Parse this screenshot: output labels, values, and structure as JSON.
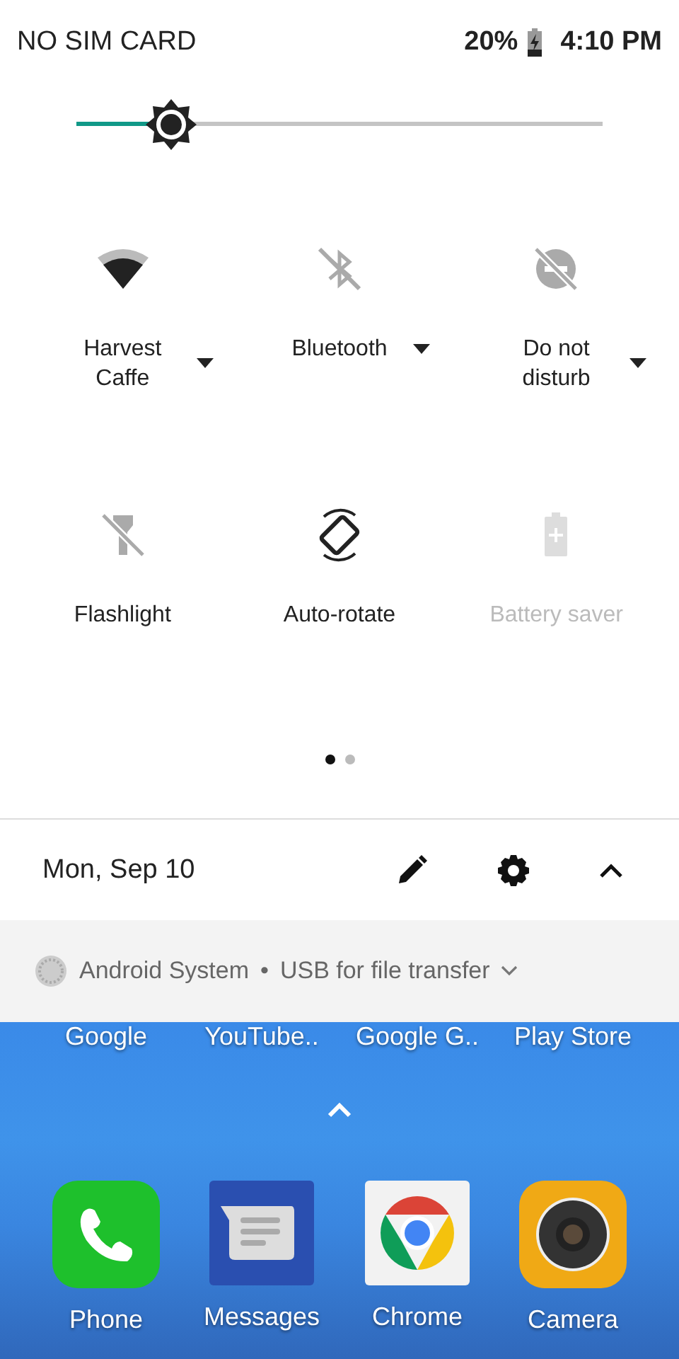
{
  "status_bar": {
    "carrier": "NO SIM CARD",
    "battery": "20%",
    "time": "4:10 PM"
  },
  "brightness": {
    "level": 0.18
  },
  "tiles": [
    {
      "kind": "wifi",
      "label": "Harvest Caffe",
      "on": true,
      "disabled": false,
      "dropdown": true
    },
    {
      "kind": "bluetooth",
      "label": "Bluetooth",
      "on": false,
      "disabled": false,
      "dropdown": true
    },
    {
      "kind": "dnd",
      "label": "Do not disturb",
      "on": false,
      "disabled": false,
      "dropdown": true
    },
    {
      "kind": "flashlight",
      "label": "Flashlight",
      "on": false,
      "disabled": false,
      "dropdown": false
    },
    {
      "kind": "rotate",
      "label": "Auto-rotate",
      "on": true,
      "disabled": false,
      "dropdown": false
    },
    {
      "kind": "battery",
      "label": "Battery saver",
      "on": false,
      "disabled": true,
      "dropdown": false
    }
  ],
  "pages": [
    {
      "selected": true
    },
    {
      "selected": false
    }
  ],
  "footer": {
    "date": "Mon, Sep 10"
  },
  "notification": {
    "app": "Android System",
    "separator": "•",
    "title": "USB for file transfer"
  },
  "home": {
    "shortcuts": [
      "Google",
      "YouTube..",
      "Google G..",
      "Play Store"
    ],
    "dock": [
      {
        "kind": "phone",
        "label": "Phone"
      },
      {
        "kind": "messages",
        "label": "Messages"
      },
      {
        "kind": "chrome",
        "label": "Chrome"
      },
      {
        "kind": "camera",
        "label": "Camera"
      }
    ]
  }
}
